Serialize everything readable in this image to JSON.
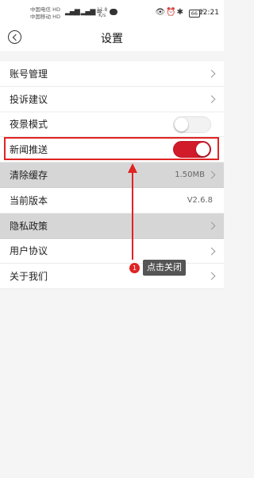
{
  "status_bar": {
    "carrier_1": "中国电信",
    "carrier_2": "中国移动",
    "carrier_tag_1": "HD",
    "carrier_tag_2": "HD",
    "net_speed_value": "11.8",
    "net_speed_unit": "K/s",
    "battery": "66",
    "time": "12:21"
  },
  "header": {
    "title": "设置"
  },
  "settings": [
    {
      "label": "账号管理",
      "type": "nav"
    },
    {
      "label": "投诉建议",
      "type": "nav"
    },
    {
      "label": "夜景模式",
      "type": "toggle",
      "enabled": false
    },
    {
      "label": "新闻推送",
      "type": "toggle",
      "enabled": true
    },
    {
      "label": "清除缓存",
      "type": "nav",
      "value": "1.50MB"
    },
    {
      "label": "当前版本",
      "type": "info",
      "value": "V2.6.8"
    },
    {
      "label": "隐私政策",
      "type": "nav"
    },
    {
      "label": "用户协议",
      "type": "nav"
    },
    {
      "label": "关于我们",
      "type": "nav"
    }
  ],
  "annotation": {
    "step_number": "1",
    "tooltip": "点击关闭",
    "accent_color": "#e02323"
  }
}
